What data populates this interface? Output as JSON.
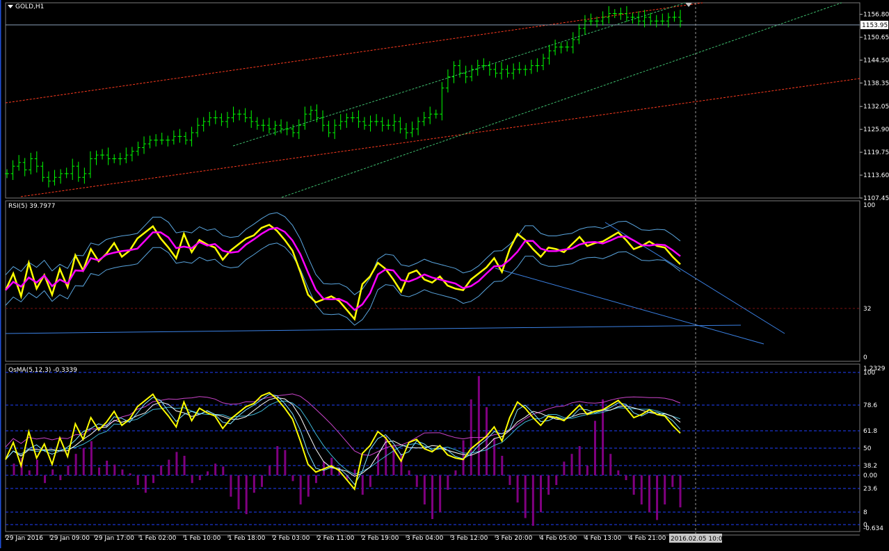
{
  "window": {
    "title": "GOLD,H1"
  },
  "price_panel": {
    "current_price": "1153.95",
    "y_ticks": [
      "1156.80",
      "1150.65",
      "1144.50",
      "1138.35",
      "1132.05",
      "1125.90",
      "1119.75",
      "1113.60",
      "1107.45"
    ]
  },
  "rsi_panel": {
    "label": "RSI(5) 39.7977",
    "y_ticks": [
      "100",
      "32",
      "0"
    ]
  },
  "osma_panel": {
    "label": "OsMA(5,12,3) -0.3339",
    "y_ticks": [
      "1.2329",
      "100",
      "78.6",
      "61.8",
      "50",
      "38.2",
      "0.00",
      "23.6",
      "8",
      "0",
      "-0.634"
    ]
  },
  "x_axis": {
    "ticks": [
      "29 Jan 2016",
      "29 Jan 09:00",
      "29 Jan 17:00",
      "1 Feb 02:00",
      "1 Feb 10:00",
      "1 Feb 18:00",
      "2 Feb 03:00",
      "2 Feb 11:00",
      "2 Feb 19:00",
      "3 Feb 04:00",
      "3 Feb 12:00",
      "3 Feb 20:00",
      "4 Feb 05:00",
      "4 Feb 13:00",
      "4 Feb 21:00"
    ],
    "cursor_time": "2016.02.05 10:00"
  },
  "colors": {
    "background": "#000000",
    "candles": "#00ff00",
    "rsi": "#ffff00",
    "rsi_ma": "#ff00ff",
    "osma_hist": "#800080",
    "channel_red": "#ff3b1f",
    "channel_green": "#3fbf6f",
    "trend_blue": "#3b82e6",
    "grid_dash": "#1f3fff"
  },
  "chart_data": [
    {
      "type": "candlestick",
      "title": "GOLD,H1",
      "ylim": [
        1107.45,
        1159.9
      ],
      "close_approx": [
        1114,
        1116,
        1117,
        1115,
        1118,
        1116,
        1113,
        1112,
        1113,
        1114,
        1114,
        1116,
        1113,
        1114,
        1118,
        1119,
        1119,
        1118,
        1118,
        1118,
        1119,
        1120,
        1121,
        1122,
        1123,
        1123,
        1123,
        1123,
        1124,
        1124,
        1123,
        1125,
        1127,
        1128,
        1129,
        1129,
        1128,
        1129,
        1130,
        1130,
        1129,
        1128,
        1127,
        1127,
        1126,
        1127,
        1126,
        1126,
        1125,
        1127,
        1130,
        1131,
        1129,
        1127,
        1125,
        1127,
        1128,
        1129,
        1129,
        1128,
        1127,
        1128,
        1128,
        1127,
        1127,
        1128,
        1126,
        1125,
        1126,
        1128,
        1129,
        1130,
        1130,
        1137,
        1140,
        1143,
        1141,
        1140,
        1142,
        1143,
        1143,
        1142,
        1141,
        1142,
        1141,
        1142,
        1142,
        1142,
        1143,
        1143,
        1145,
        1147,
        1148,
        1148,
        1148,
        1150,
        1153,
        1155,
        1155,
        1155,
        1156,
        1157,
        1157,
        1157,
        1156,
        1156,
        1155,
        1156,
        1155,
        1155,
        1155,
        1156,
        1156,
        1155
      ]
    },
    {
      "type": "line",
      "title": "RSI(5) 39.7977",
      "ylim": [
        0,
        100
      ],
      "series": [
        {
          "values": [
            44,
            55,
            40,
            62,
            45,
            54,
            41,
            58,
            46,
            67,
            57,
            71,
            63,
            68,
            75,
            66,
            70,
            78,
            82,
            86,
            78,
            72,
            65,
            81,
            69,
            77,
            74,
            72,
            64,
            70,
            74,
            78,
            80,
            85,
            87,
            83,
            77,
            70,
            56,
            41,
            36,
            38,
            40,
            37,
            31,
            25,
            48,
            53,
            62,
            58,
            51,
            43,
            55,
            57,
            51,
            49,
            53,
            47,
            45,
            44,
            51,
            55,
            59,
            65,
            56,
            71,
            81,
            77,
            71,
            66,
            72,
            71,
            69,
            74,
            79,
            73,
            75,
            76,
            79,
            82,
            77,
            71,
            73,
            76,
            73,
            72,
            66,
            61
          ]
        }
      ]
    },
    {
      "type": "bar",
      "title": "OsMA(5,12,3) -0.3339",
      "ylim": [
        -0.634,
        1.2329
      ],
      "values": [
        0.12,
        0.18,
        0.05,
        0.16,
        -0.08,
        0.06,
        -0.05,
        0.1,
        0.22,
        0.28,
        0.35,
        0.08,
        0.15,
        0.11,
        0.06,
        0.02,
        -0.1,
        -0.18,
        -0.08,
        0.1,
        0.16,
        0.24,
        0.2,
        -0.08,
        -0.05,
        0.04,
        0.12,
        0.09,
        -0.22,
        -0.35,
        -0.4,
        -0.18,
        -0.12,
        0.1,
        0.3,
        0.26,
        -0.06,
        -0.3,
        -0.22,
        -0.08,
        0.14,
        0.18,
        0.08,
        -0.05,
        0.06,
        -0.2,
        -0.12,
        0.22,
        0.4,
        0.3,
        0.22,
        0.05,
        -0.12,
        -0.3,
        -0.45,
        -0.38,
        -0.15,
        0.05,
        0.36,
        0.78,
        1.02,
        0.7,
        0.38,
        0.2,
        -0.1,
        -0.28,
        -0.44,
        -0.52,
        -0.38,
        -0.2,
        -0.1,
        0.14,
        0.22,
        0.3,
        0.1,
        0.56,
        0.78,
        0.22,
        0.05,
        -0.05,
        -0.2,
        -0.3,
        -0.38,
        -0.46,
        -0.3,
        -0.12,
        -0.33
      ]
    }
  ]
}
